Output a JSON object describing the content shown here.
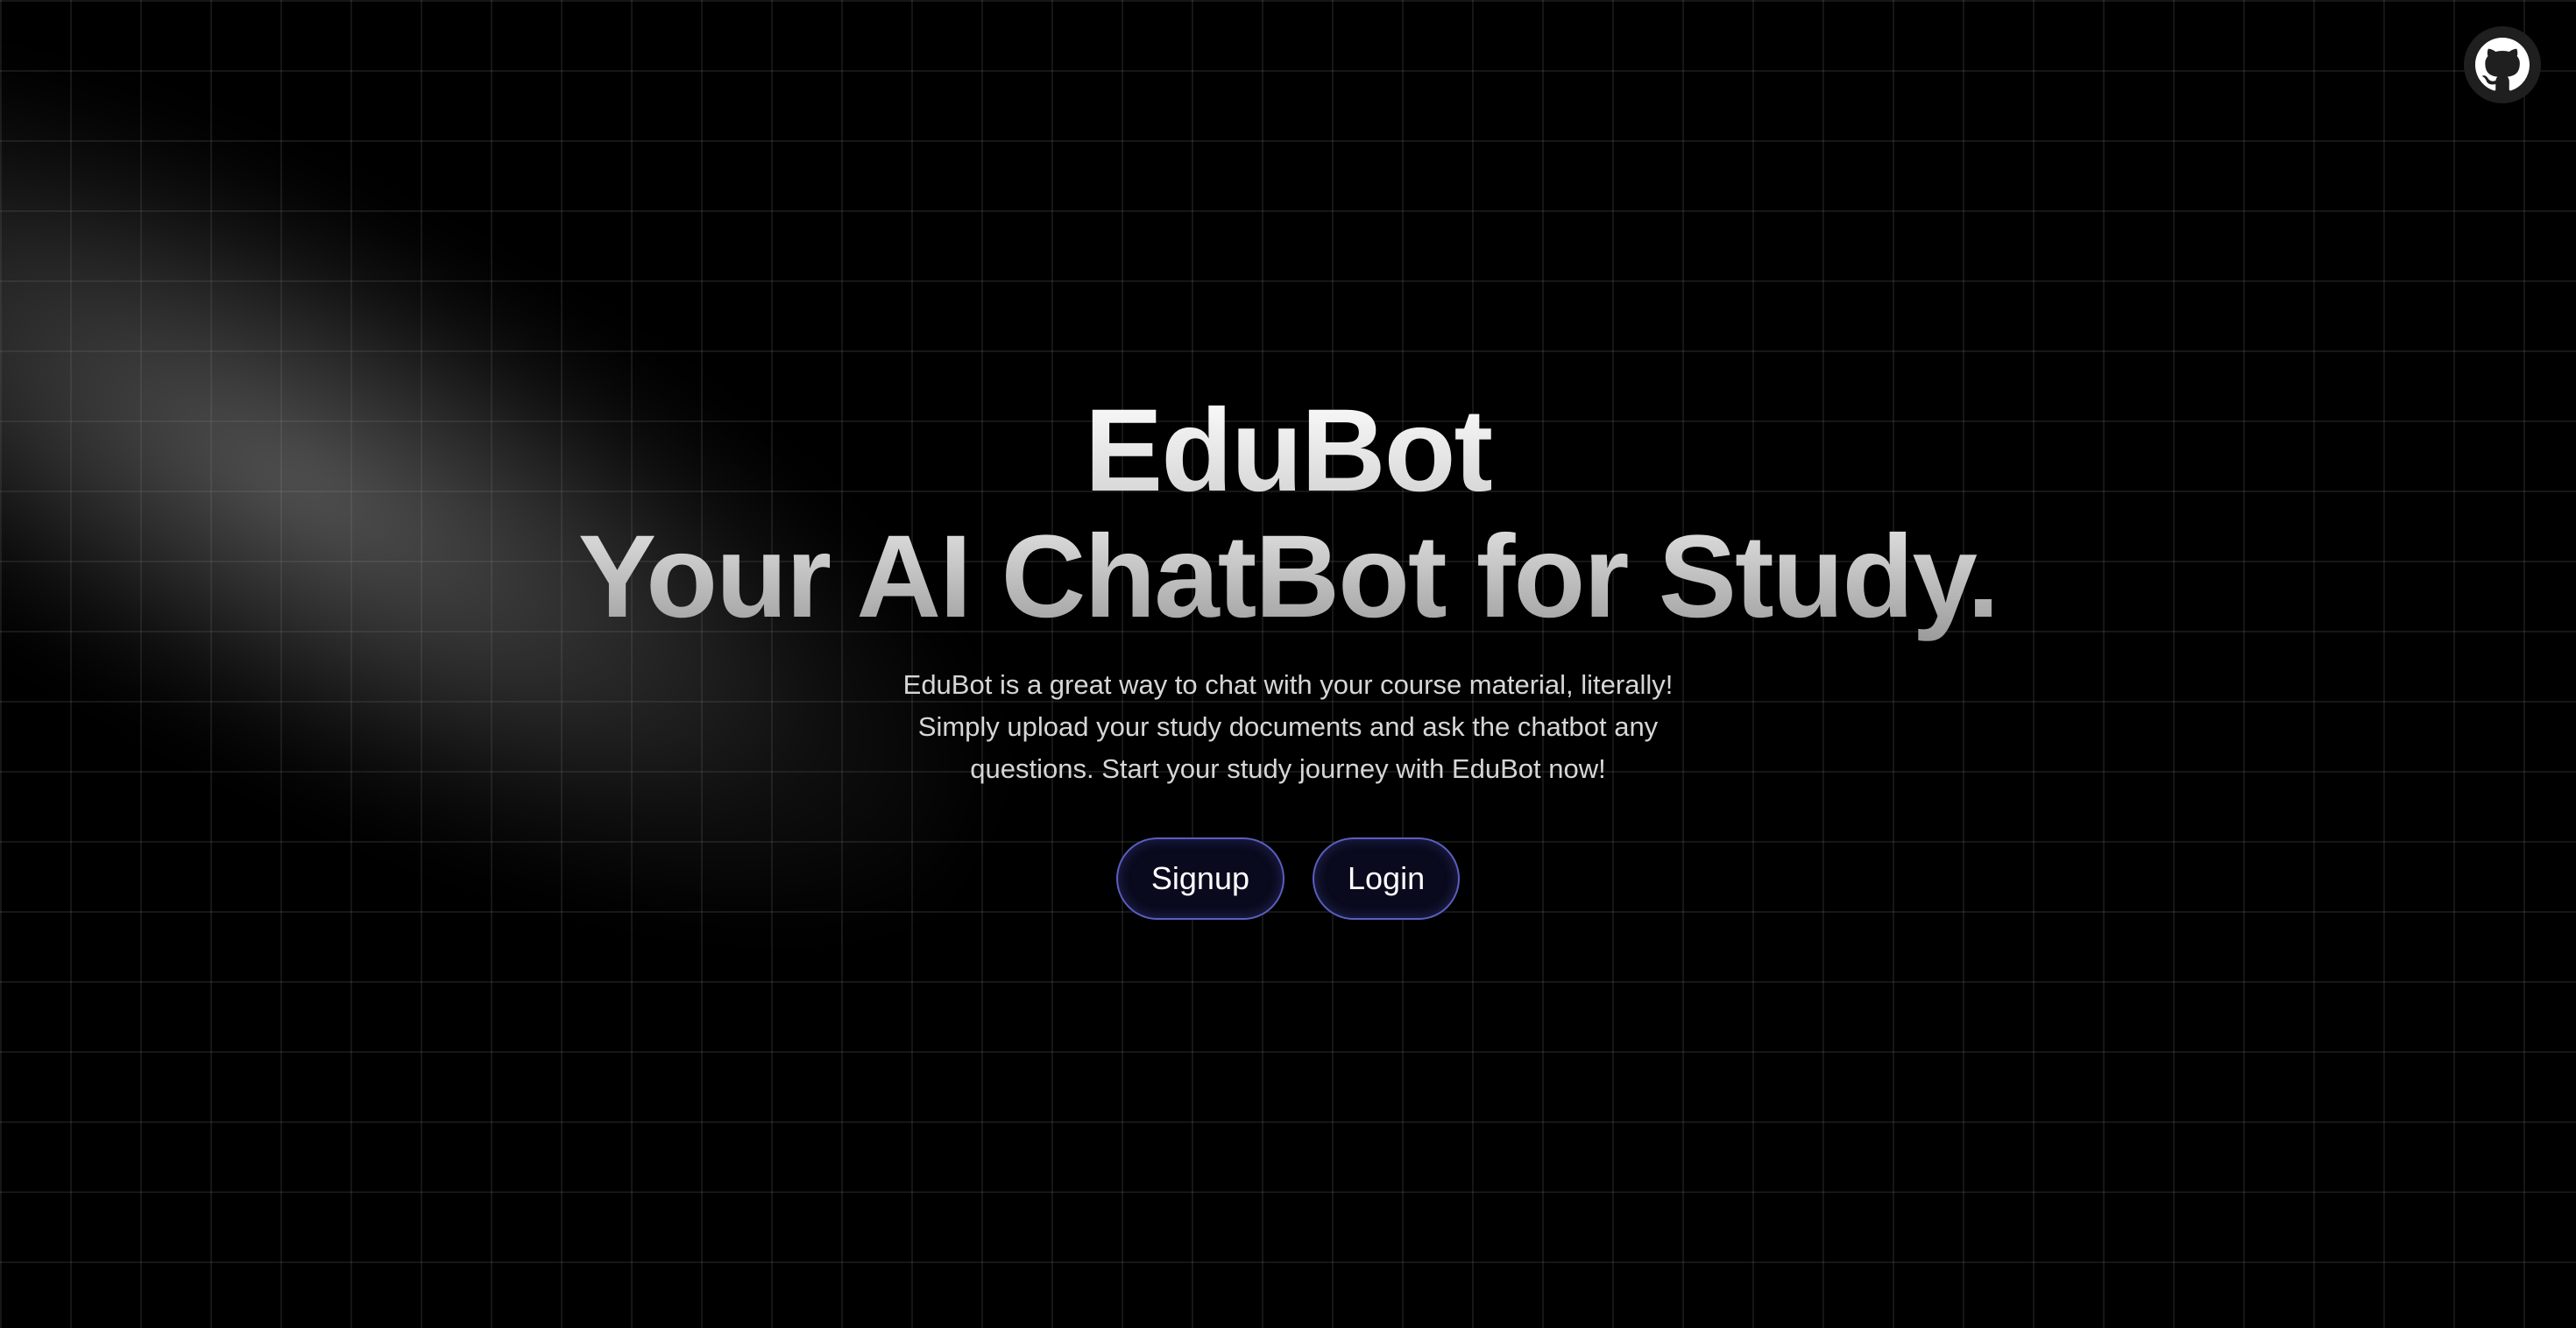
{
  "header": {
    "github_link": {
      "icon": "github-icon"
    }
  },
  "hero": {
    "title": "EduBot",
    "subtitle": "Your AI ChatBot for Study.",
    "description": "EduBot is a great way to chat with your course material, literally! Simply upload your study documents and ask the chatbot any questions. Start your study journey with EduBot now!"
  },
  "actions": {
    "signup_label": "Signup",
    "login_label": "Login"
  },
  "colors": {
    "background": "#000000",
    "button_background": "#0a0a1e",
    "button_border": "#5a5fc0",
    "text_primary": "#ffffff",
    "text_secondary": "#d6d6d6"
  }
}
